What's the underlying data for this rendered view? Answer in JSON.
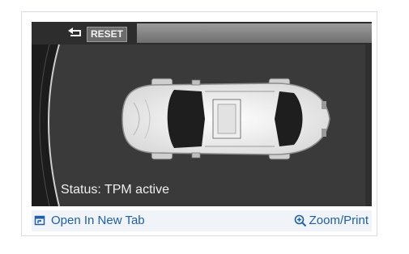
{
  "screen": {
    "back_icon": "return-arrow-icon",
    "reset_label": "RESET",
    "status_text": "Status: TPM active"
  },
  "footer": {
    "open_tab_label": "Open In New Tab",
    "open_tab_icon": "open-new-tab-icon",
    "zoom_label": "Zoom/Print",
    "zoom_icon": "magnifier-plus-icon"
  },
  "colors": {
    "screen_bg": "#3a3a3a",
    "link": "#1f5fa6",
    "footer_bg": "#f0f3f7"
  }
}
